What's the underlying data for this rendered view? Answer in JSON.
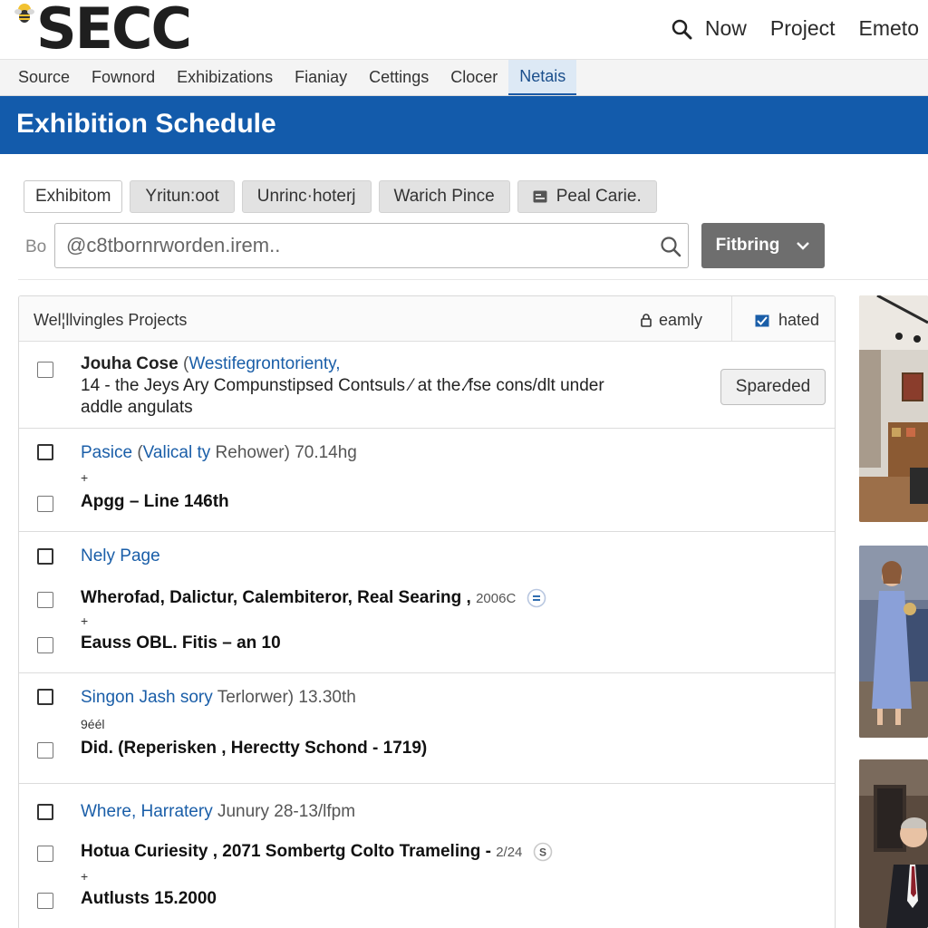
{
  "header": {
    "logo_text": "SECC",
    "nav": [
      "Now",
      "Project",
      "Emeto"
    ]
  },
  "menu": {
    "items": [
      "Source",
      "Fownord",
      "Exhibizations",
      "Fianiay",
      "Cettings",
      "Clocer",
      "Netais"
    ],
    "active": "Netais"
  },
  "page_title": "Exhibition Schedule",
  "tabs": [
    "Exhibitom",
    "Yritun:oot",
    "Unrinc·hoterj",
    "Warich Pince",
    "Peal Carie."
  ],
  "search": {
    "prefix": "Bo",
    "placeholder": "@c8tbornrworden.irem..",
    "value": ""
  },
  "filter_button": "Fitbring",
  "panel": {
    "title": "Wel¦llvingles Projects",
    "sort_label": "eamly",
    "rated_label": "hated"
  },
  "rows": [
    {
      "name": "Jouha Cose",
      "link": "Westifegrontorienty,",
      "line2": "14 - the Jeys Ary Compunstipsed Contsuls ⁄ at the.⁄fse cons/dlt under",
      "line3": "addle angulats",
      "button": "Spareded"
    },
    {
      "link": "Pasice",
      "link2": "Valical ty",
      "rest": "Rehower) 70.14hg",
      "plus": "+",
      "bold": "Apgg – Line 146th"
    },
    {
      "link": "Nely Page",
      "bold1": "Wherofad, Dalictur, Calembiteror, Real Searing ,",
      "tag": "2006C",
      "plus": "+",
      "bold2": "Eauss OBL. Fitis – an 10"
    },
    {
      "link": "Singon Jash sory",
      "rest": "Terlorwer) 13.30th",
      "small": "9éél",
      "bold": "Did. (Reperisken , Herectty Schond - 1719)"
    },
    {
      "link": "Where, Harratery",
      "rest": "Junury 28-13/lfpm",
      "bold1": "Hotua Curiesity , 2071 Sombertg Colto Trameling -",
      "tag": "2/24",
      "plus": "+",
      "bold2": "Autlusts 15.2000"
    }
  ],
  "colors": {
    "brand_blue": "#135bab",
    "link_blue": "#1a5ea8",
    "filter_gray": "#6e6e6e"
  },
  "icons": [
    "bee-logo-icon",
    "search-icon",
    "tab-card-icon",
    "search-glass-icon",
    "chevron-down-icon",
    "lock-icon",
    "checked-box-icon",
    "info-circle-icon"
  ]
}
